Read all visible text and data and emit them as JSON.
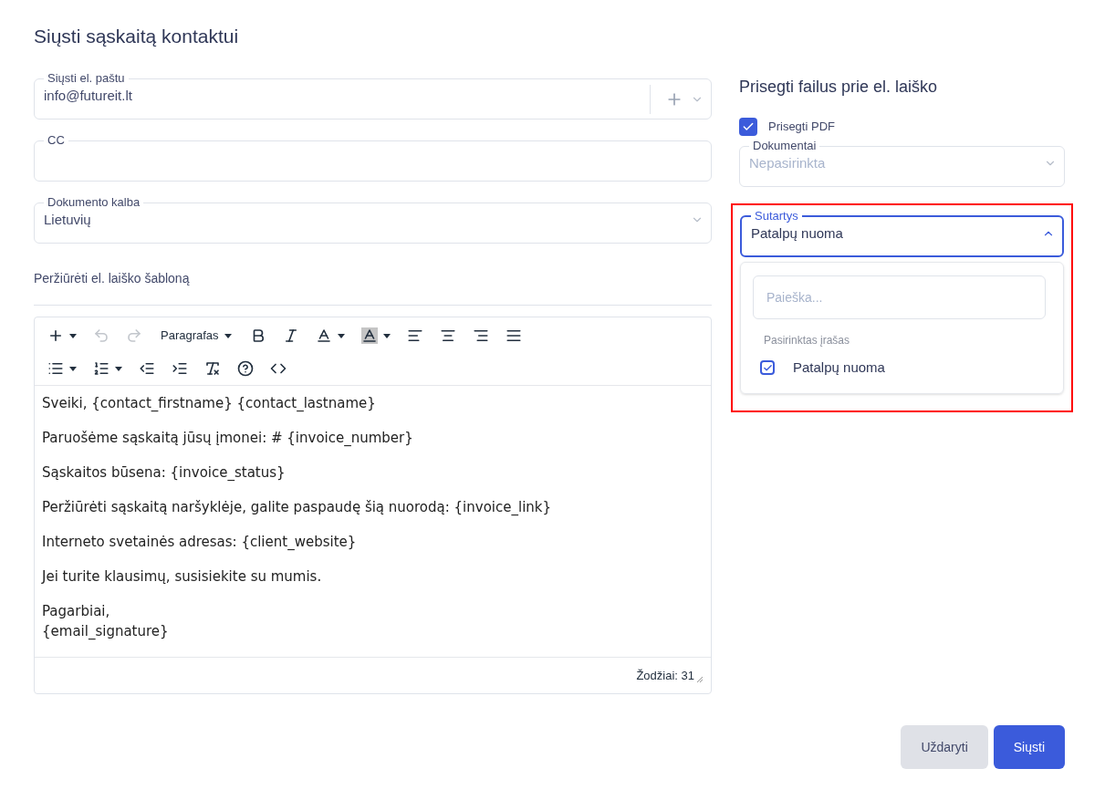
{
  "dialog": {
    "title": "Siųsti sąskaitą kontaktui"
  },
  "email": {
    "label": "Siųsti el. paštu",
    "value": "info@futureit.lt"
  },
  "cc": {
    "label": "CC"
  },
  "language": {
    "label": "Dokumento kalba",
    "value": "Lietuvių"
  },
  "template_link": "Peržiūrėti el. laiško šabloną",
  "editor": {
    "block_format": "Paragrafas",
    "undo": {
      "disabled": true
    },
    "redo": {
      "disabled": true
    },
    "paragraphs": [
      {
        "lines": [
          "Sveiki, {contact_firstname} {contact_lastname}"
        ]
      },
      {
        "lines": [
          "Paruošėme sąskaitą jūsų įmonei: # {invoice_number}"
        ]
      },
      {
        "lines": [
          "Sąskaitos būsena: {invoice_status}"
        ]
      },
      {
        "lines": [
          "Peržiūrėti sąskaitą naršyklėje, galite paspaudę šią nuorodą: {invoice_link}"
        ]
      },
      {
        "lines": [
          "Interneto svetainės adresas: {client_website}"
        ]
      },
      {
        "lines": [
          "Jei turite klausimų, susisiekite su mumis."
        ]
      },
      {
        "lines": [
          "Pagarbiai,",
          "{email_signature}"
        ]
      }
    ],
    "word_count": "Žodžiai: 31"
  },
  "attachments": {
    "title": "Prisegti failus prie el. laiško",
    "attach_pdf": {
      "label": "Prisegti PDF",
      "checked": true
    },
    "documents": {
      "label": "Dokumentai",
      "placeholder": "Nepasirinkta"
    },
    "contracts": {
      "label": "Sutartys",
      "value": "Patalpų nuoma",
      "expanded": true,
      "highlighted": true,
      "search_placeholder": "Paieška...",
      "group_label": "Pasirinktas įrašas",
      "options": [
        {
          "label": "Patalpų nuoma",
          "selected": true
        }
      ]
    }
  },
  "buttons": [
    {
      "label": "Uždaryti",
      "kind": "secondary"
    },
    {
      "label": "Siųsti",
      "kind": "primary"
    }
  ]
}
